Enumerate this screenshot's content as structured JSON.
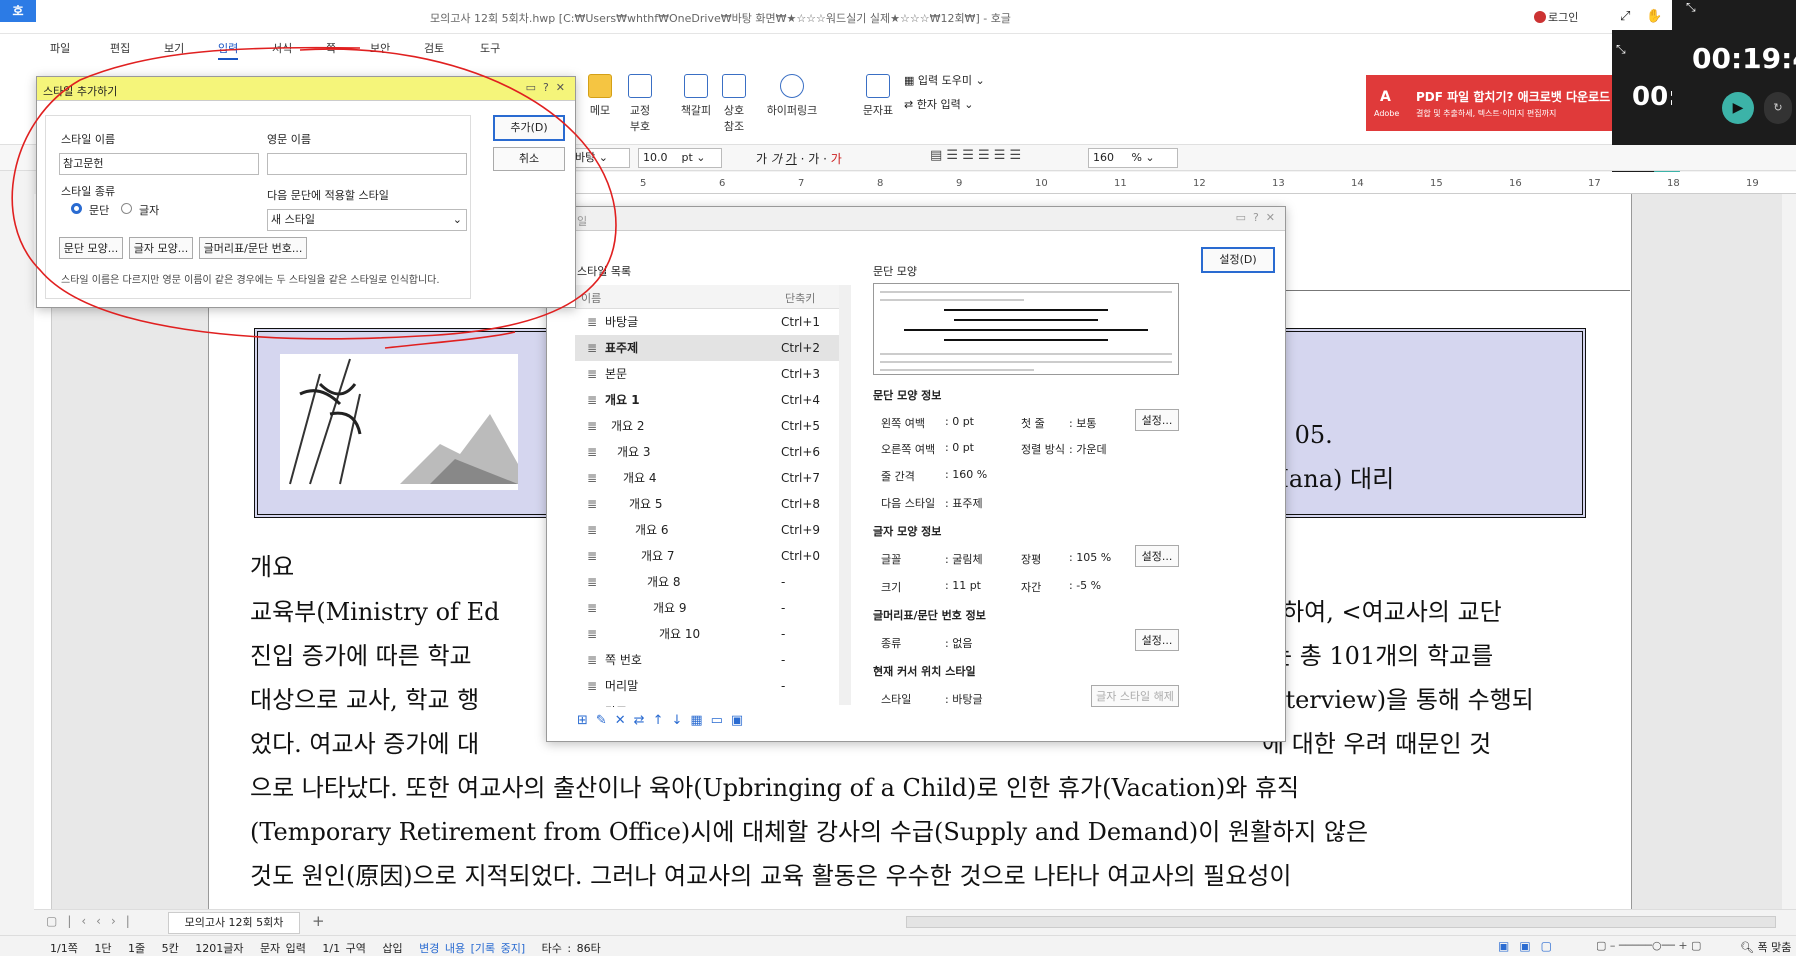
{
  "window": {
    "app_icon": "호",
    "title": "모의고사 12회 5회차.hwp [C:₩Users₩whthf₩OneDrive₩바탕 화면₩★☆☆☆워드실기 실제★☆☆☆₩12회₩] - 호글",
    "login": "로그인"
  },
  "menu": [
    "파일",
    "편집",
    "보기",
    "입력",
    "서식",
    "쪽",
    "보안",
    "검토",
    "도구"
  ],
  "ribbon": {
    "memo": "메모",
    "proof": "교정\n부호",
    "bookmark": "책갈피",
    "crossref": "상호\n참조",
    "hyperlink": "하이퍼링크",
    "chartable": "문자표",
    "input_tool": "입력 도우미",
    "hanja": "한자 입력"
  },
  "ad": {
    "text": "PDF 파일 합치기? 애크로뱃 다운로드",
    "sub": "결합 및 추출하세, 텍스트·이미지 편집까지",
    "brand": "Adobe"
  },
  "timer": {
    "big": "00:19:4",
    "small": "00:"
  },
  "format": {
    "font": "바탕",
    "size": "10.0",
    "unit": "pt",
    "zoom": "160",
    "zoom_unit": "%"
  },
  "ruler_nums": [
    "5",
    "6",
    "7",
    "8",
    "9",
    "10",
    "11",
    "12",
    "13",
    "14",
    "15",
    "16",
    "17",
    "18",
    "19"
  ],
  "doc": {
    "header_date": "). 05.",
    "header_name": "Hana) 대리",
    "heading": "개요",
    "lines": [
      "교육부(Ministry of Ed",
      "진입 증가에 따른 학교",
      "대상으로 교사, 학교 행",
      "었다. 여교사 증가에 대",
      "으로 나타났다. 또한 여교사의 출산이나 육아(Upbringing of a Child)로 인한 휴가(Vacation)와 휴직",
      "(Temporary Retirement from Office)시에 대체할 강사의 수급(Supply and Demand)이 원활하지 않은",
      "것도 원인(原因)으로 지적되었다. 그러나 여교사의 교육 활동은 우수한 것으로 나타나 여교사의 필요성이"
    ],
    "right_frags": [
      "위하여, <여교사의 교단",
      "는 총 101개의 학교를",
      "nterview)을 통해 수행되",
      "에 대한 우려 때문인 것"
    ]
  },
  "add_dialog": {
    "title": "스타일 추가하기",
    "name_label": "스타일 이름",
    "eng_label": "영문 이름",
    "name_value": "참고문헌",
    "eng_value": "",
    "kind_label": "스타일 종류",
    "kind_para": "문단",
    "kind_char": "글자",
    "next_label": "다음 문단에 적용할 스타일",
    "next_value": "새 스타일",
    "btn_para": "문단 모양...",
    "btn_char": "글자 모양...",
    "btn_bullet": "글머리표/문단 번호...",
    "add": "추가(D)",
    "cancel": "취소",
    "note": "스타일 이름은 다르지만 영문 이름이 같은 경우에는 두 스타일을 같은 스타일로 인식합니다."
  },
  "style_dialog": {
    "title": "일",
    "set_btn": "설정(D)",
    "list_label": "스타일 목록",
    "col_name": "이름",
    "col_key": "단축키",
    "items": [
      {
        "name": "바탕글",
        "key": "Ctrl+1"
      },
      {
        "name": "표주제",
        "key": "Ctrl+2"
      },
      {
        "name": "본문",
        "key": "Ctrl+3"
      },
      {
        "name": "개요 1",
        "key": "Ctrl+4"
      },
      {
        "name": "개요 2",
        "key": "Ctrl+5"
      },
      {
        "name": "개요 3",
        "key": "Ctrl+6"
      },
      {
        "name": "개요 4",
        "key": "Ctrl+7"
      },
      {
        "name": "개요 5",
        "key": "Ctrl+8"
      },
      {
        "name": "개요 6",
        "key": "Ctrl+9"
      },
      {
        "name": "개요 7",
        "key": "Ctrl+0"
      },
      {
        "name": "개요 8",
        "key": "-"
      },
      {
        "name": "개요 9",
        "key": "-"
      },
      {
        "name": "개요 10",
        "key": "-"
      },
      {
        "name": "쪽 번호",
        "key": "-"
      },
      {
        "name": "머리말",
        "key": "-"
      },
      {
        "name": "각주",
        "key": "-"
      }
    ],
    "para_shape": "문단 모양",
    "para_info": "문단 모양 정보",
    "left_margin": "왼쪽 여백",
    "left_val": ": 0 pt",
    "first_line": "첫 줄",
    "first_val": ": 보통",
    "right_margin": "오른쪽 여백",
    "right_val": ": 0 pt",
    "align": "정렬 방식",
    "align_val": ": 가운데",
    "line_spacing": "줄 간격",
    "line_val": ": 160 %",
    "next_style": "다음 스타일",
    "next_val": ": 표주제",
    "char_info": "글자 모양 정보",
    "font": "글꼴",
    "font_val": ": 굴림체",
    "ratio": "장평",
    "ratio_val": ": 105 %",
    "size": "크기",
    "size_val": ": 11 pt",
    "spacing": "자간",
    "spacing_val": ": -5 %",
    "bullet_info": "글머리표/문단 번호 정보",
    "kind": "종류",
    "kind_val": ": 없음",
    "cursor_info": "현재 커서 위치 스타일",
    "style": "스타일",
    "style_val": ": 바탕글",
    "release": "글자 스타일 해제",
    "setting": "설정..."
  },
  "tab": {
    "name": "모의고사 12회 5회차",
    "add": "+"
  },
  "status": {
    "page": "1/1쪽",
    "col": "1단",
    "line": "1줄",
    "pos": "5칸",
    "chars": "1201글자",
    "mode": "문자 입력",
    "section": "1/1 구역",
    "insert": "삽입",
    "track": "변경 내용 [기록 중지]",
    "typing": "타수 : 86타",
    "zoomfit": "폭 맞춤"
  }
}
